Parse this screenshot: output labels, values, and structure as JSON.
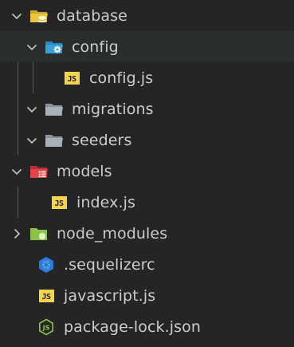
{
  "explorer": {
    "items": [
      {
        "label": "database",
        "icon": "folder-database-open-icon",
        "expanded": true
      },
      {
        "label": "config",
        "icon": "folder-config-open-icon",
        "expanded": true,
        "selected": true
      },
      {
        "label": "config.js",
        "icon": "javascript-file-icon",
        "badge": "JS"
      },
      {
        "label": "migrations",
        "icon": "folder-open-icon",
        "expanded": true
      },
      {
        "label": "seeders",
        "icon": "folder-open-icon",
        "expanded": true
      },
      {
        "label": "models",
        "icon": "folder-models-open-icon",
        "expanded": true
      },
      {
        "label": "index.js",
        "icon": "javascript-file-icon",
        "badge": "JS"
      },
      {
        "label": "node_modules",
        "icon": "folder-node-closed-icon",
        "expanded": false
      },
      {
        "label": ".sequelizerc",
        "icon": "sequelize-file-icon"
      },
      {
        "label": "javascript.js",
        "icon": "javascript-file-icon",
        "badge": "JS"
      },
      {
        "label": "package-lock.json",
        "icon": "nodejs-file-icon"
      }
    ]
  },
  "colors": {
    "background": "#252526",
    "selected_row": "#2a2d2e",
    "text": "#cccccc",
    "js_badge": "#f5d44a",
    "database_folder": "#e8c542",
    "config_folder": "#3aa0d8",
    "plain_folder": "#a8b0b8",
    "models_folder": "#e0434b",
    "node_folder": "#8bc34a",
    "nodejs_icon": "#8bc34a",
    "sequelize_icon": "#2c7bd6"
  }
}
